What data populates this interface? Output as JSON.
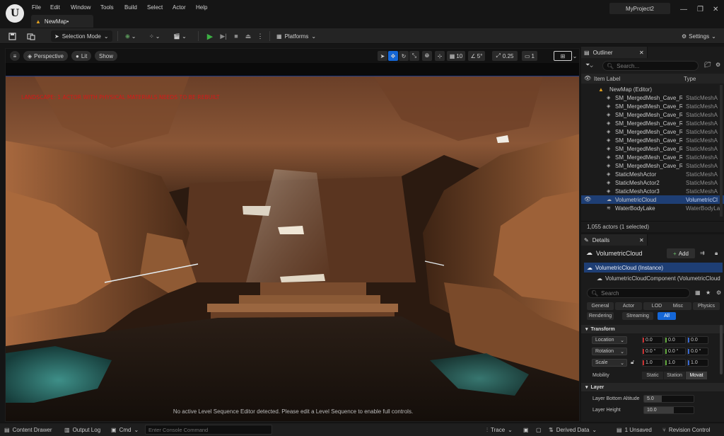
{
  "menu": [
    "File",
    "Edit",
    "Window",
    "Tools",
    "Build",
    "Select",
    "Actor",
    "Help"
  ],
  "level_tab": "NewMap•",
  "project_name": "MyProject2",
  "toolbar": {
    "selection_mode": "Selection Mode",
    "platforms": "Platforms",
    "settings": "Settings"
  },
  "viewport": {
    "perspective": "Perspective",
    "lit": "Lit",
    "show": "Show",
    "grid_snap": "10",
    "rotation_snap": "5°",
    "scale_snap": "0.25",
    "camera_speed": "1",
    "warning": "LANDSCAPE: 1 ACTOR WITH PHYSICAL MATERIALS NEEDS TO BE REBUILT",
    "sequence_message": "No active Level Sequence Editor detected. Please edit a Level Sequence to enable full controls."
  },
  "outliner": {
    "tab": "Outliner",
    "search_placeholder": "Search...",
    "col_label": "Item Label",
    "col_type": "Type",
    "root": "NewMap (Editor)",
    "rows": [
      {
        "label": "SM_MergedMesh_Cave_Rc",
        "type": "StaticMeshA"
      },
      {
        "label": "SM_MergedMesh_Cave_Rc",
        "type": "StaticMeshA"
      },
      {
        "label": "SM_MergedMesh_Cave_Rc",
        "type": "StaticMeshA"
      },
      {
        "label": "SM_MergedMesh_Cave_Rc",
        "type": "StaticMeshA"
      },
      {
        "label": "SM_MergedMesh_Cave_Rc",
        "type": "StaticMeshA"
      },
      {
        "label": "SM_MergedMesh_Cave_Rc",
        "type": "StaticMeshA"
      },
      {
        "label": "SM_MergedMesh_Cave_Rc",
        "type": "StaticMeshA"
      },
      {
        "label": "SM_MergedMesh_Cave_Rc",
        "type": "StaticMeshA"
      },
      {
        "label": "SM_MergedMesh_Cave_Rc",
        "type": "StaticMeshA"
      },
      {
        "label": "StaticMeshActor",
        "type": "StaticMeshA"
      },
      {
        "label": "StaticMeshActor2",
        "type": "StaticMeshA"
      },
      {
        "label": "StaticMeshActor3",
        "type": "StaticMeshA"
      },
      {
        "label": "VolumetricCloud",
        "type": "VolumetricCl"
      },
      {
        "label": "WaterBodyLake",
        "type": "WaterBodyLa"
      }
    ],
    "footer": "1,055 actors (1 selected)"
  },
  "details": {
    "tab": "Details",
    "actor_name": "VolumetricCloud",
    "add_label": "Add",
    "instance": "VolumetricCloud (Instance)",
    "component": "VolumetricCloudComponent (VolumetricCloud",
    "search_placeholder": "Search",
    "filters_row1": [
      "General",
      "Actor",
      "LOD",
      "Misc",
      "Physics"
    ],
    "filters_row2": [
      "Rendering",
      "Streaming",
      "All"
    ],
    "transform": {
      "title": "Transform",
      "location_label": "Location",
      "location": [
        "0.0",
        "0.0",
        "0.0"
      ],
      "rotation_label": "Rotation",
      "rotation": [
        "0.0 °",
        "0.0 °",
        "0.0 °"
      ],
      "scale_label": "Scale",
      "scale": [
        "1.0",
        "1.0",
        "1.0"
      ],
      "mobility_label": "Mobility",
      "mobility_options": [
        "Static",
        "Station",
        "Movat"
      ]
    },
    "layer": {
      "title": "Layer",
      "bottom_altitude_label": "Layer Bottom Altitude",
      "bottom_altitude": "5.0",
      "height_label": "Layer Height",
      "height": "10.0"
    }
  },
  "statusbar": {
    "content_drawer": "Content Drawer",
    "output_log": "Output Log",
    "cmd": "Cmd",
    "console_placeholder": "Enter Console Command",
    "trace": "Trace",
    "derived_data": "Derived Data",
    "unsaved": "1 Unsaved",
    "revision_control": "Revision Control"
  },
  "colors": {
    "accent": "#1466d6",
    "selection": "#1e3e74",
    "play_green": "#3cb043",
    "warning_red": "#d81818"
  }
}
